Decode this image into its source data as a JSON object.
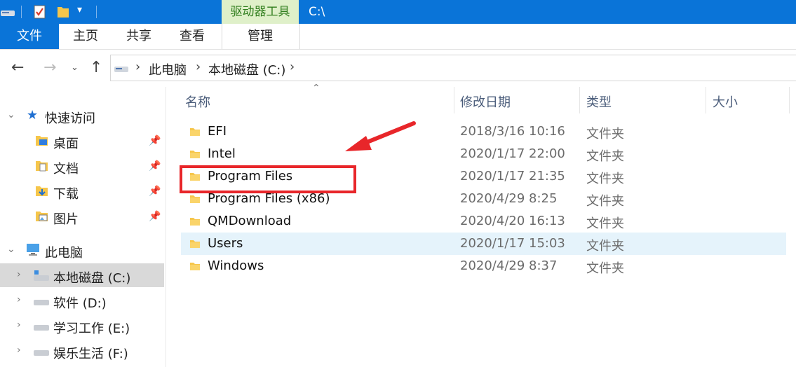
{
  "titlebar": {
    "contextual_tab": "驱动器工具",
    "path": "C:\\"
  },
  "ribbon": {
    "tabs": [
      "文件",
      "主页",
      "共享",
      "查看"
    ],
    "manage": "管理"
  },
  "address": {
    "crumbs": [
      "此电脑",
      "本地磁盘 (C:)"
    ]
  },
  "nav": {
    "quick_access": "快速访问",
    "pinned": [
      "桌面",
      "文档",
      "下载",
      "图片"
    ],
    "this_pc": "此电脑",
    "drives": [
      "本地磁盘 (C:)",
      "软件 (D:)",
      "学习工作 (E:)",
      "娱乐生活 (F:)"
    ]
  },
  "columns": {
    "name": "名称",
    "modified": "修改日期",
    "type": "类型",
    "size": "大小"
  },
  "files": [
    {
      "name": "EFI",
      "modified": "2018/3/16 10:16",
      "type": "文件夹"
    },
    {
      "name": "Intel",
      "modified": "2020/1/17 22:00",
      "type": "文件夹"
    },
    {
      "name": "Program Files",
      "modified": "2020/1/17 21:35",
      "type": "文件夹"
    },
    {
      "name": "Program Files (x86)",
      "modified": "2020/4/29 8:25",
      "type": "文件夹"
    },
    {
      "name": "QMDownload",
      "modified": "2020/4/20 16:13",
      "type": "文件夹"
    },
    {
      "name": "Users",
      "modified": "2020/1/17 15:03",
      "type": "文件夹"
    },
    {
      "name": "Windows",
      "modified": "2020/4/29 8:37",
      "type": "文件夹"
    }
  ],
  "colors": {
    "accent": "#0a74d8",
    "annotation": "#e8262a",
    "folder": "#f6c64b"
  }
}
